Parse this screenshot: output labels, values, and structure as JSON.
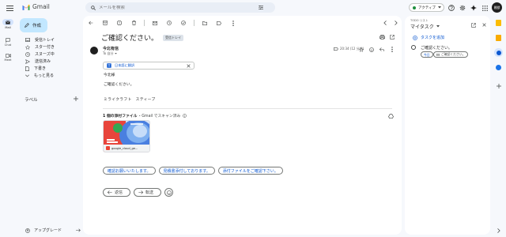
{
  "header": {
    "app_name": "Gmail",
    "search_placeholder": "メールを検索",
    "status": "アクティブ",
    "avatar_initials": "稚獣"
  },
  "rail": [
    {
      "label": "Mail",
      "icon": "mail-icon"
    },
    {
      "label": "Chat",
      "icon": "chat-icon"
    },
    {
      "label": "Meet",
      "icon": "video-icon"
    }
  ],
  "sidebar": {
    "compose_label": "作成",
    "items": [
      {
        "label": "受信トレイ",
        "icon": "inbox-icon"
      },
      {
        "label": "スター付き",
        "icon": "star-icon"
      },
      {
        "label": "スヌーズ中",
        "icon": "clock-icon"
      },
      {
        "label": "送信済み",
        "icon": "send-icon"
      },
      {
        "label": "下書き",
        "icon": "draft-icon"
      },
      {
        "label": "もっと見る",
        "icon": "chevron-down-icon"
      }
    ],
    "labels_heading": "ラベル",
    "upgrade_label": "アップグレード"
  },
  "message": {
    "subject": "ご確認ください。",
    "folder_badge": "受信トレイ",
    "sender_name": "今北有信",
    "recipient": "To 自分",
    "timestamp": "20:34 (12 分前)",
    "translate_label": "日本語に翻訳",
    "body_lines": [
      "今北様",
      "ご確認ください。",
      "ミライクラフト　スティーブ"
    ],
    "attachments_heading": "1 個の添付ファイル",
    "attachments_scan": "・Gmail でスキャン済み",
    "attachment_name": "google_cloud_ge...",
    "smart_replies": [
      "確認お願いいたします。",
      "見積書添付しております。",
      "添付ファイルをご確認下さい。"
    ],
    "reply_label": "返信",
    "forward_label": "転送"
  },
  "tasks": {
    "overline": "TODO リスト",
    "title": "マイタスク",
    "add_label": "タスクを追加",
    "task_title": "ご確認ください。",
    "due_label": "今日",
    "link_label": "ご確認ください。"
  },
  "colors": {
    "accent": "#0b57d0",
    "compose_bg": "#c2e7ff",
    "active_green": "#1e8e3e"
  }
}
